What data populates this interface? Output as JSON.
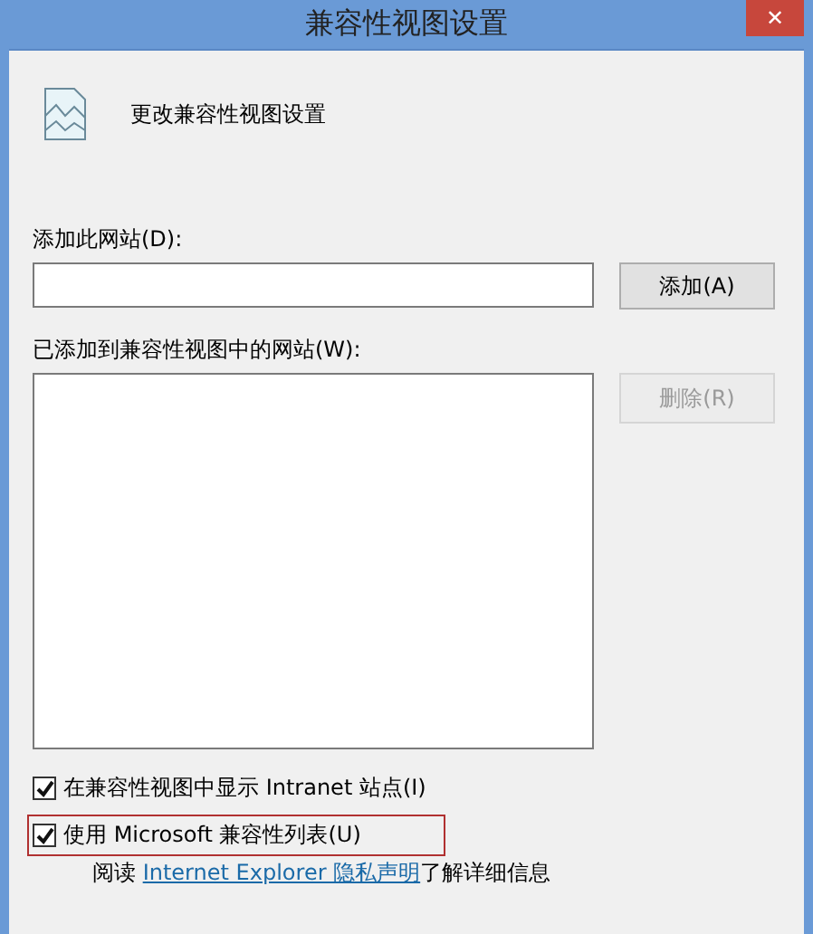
{
  "window": {
    "title": "兼容性视图设置",
    "close": "✕"
  },
  "header": {
    "text": "更改兼容性视图设置"
  },
  "add_site": {
    "label": "添加此网站(D):",
    "button": {
      "label": "添加(A)",
      "disabled": false
    }
  },
  "sites": {
    "label": "已添加到兼容性视图中的网站(W):",
    "button": {
      "label": "删除(R)",
      "disabled": true
    }
  },
  "options": [
    {
      "label": "在兼容性视图中显示 Intranet 站点(I)",
      "checked": true,
      "highlighted": false
    },
    {
      "label": "使用 Microsoft 兼容性列表(U)",
      "checked": true,
      "highlighted": true
    }
  ],
  "footer": {
    "before": "阅读 ",
    "link": "Internet Explorer 隐私声明",
    "after": "了解详细信息"
  }
}
